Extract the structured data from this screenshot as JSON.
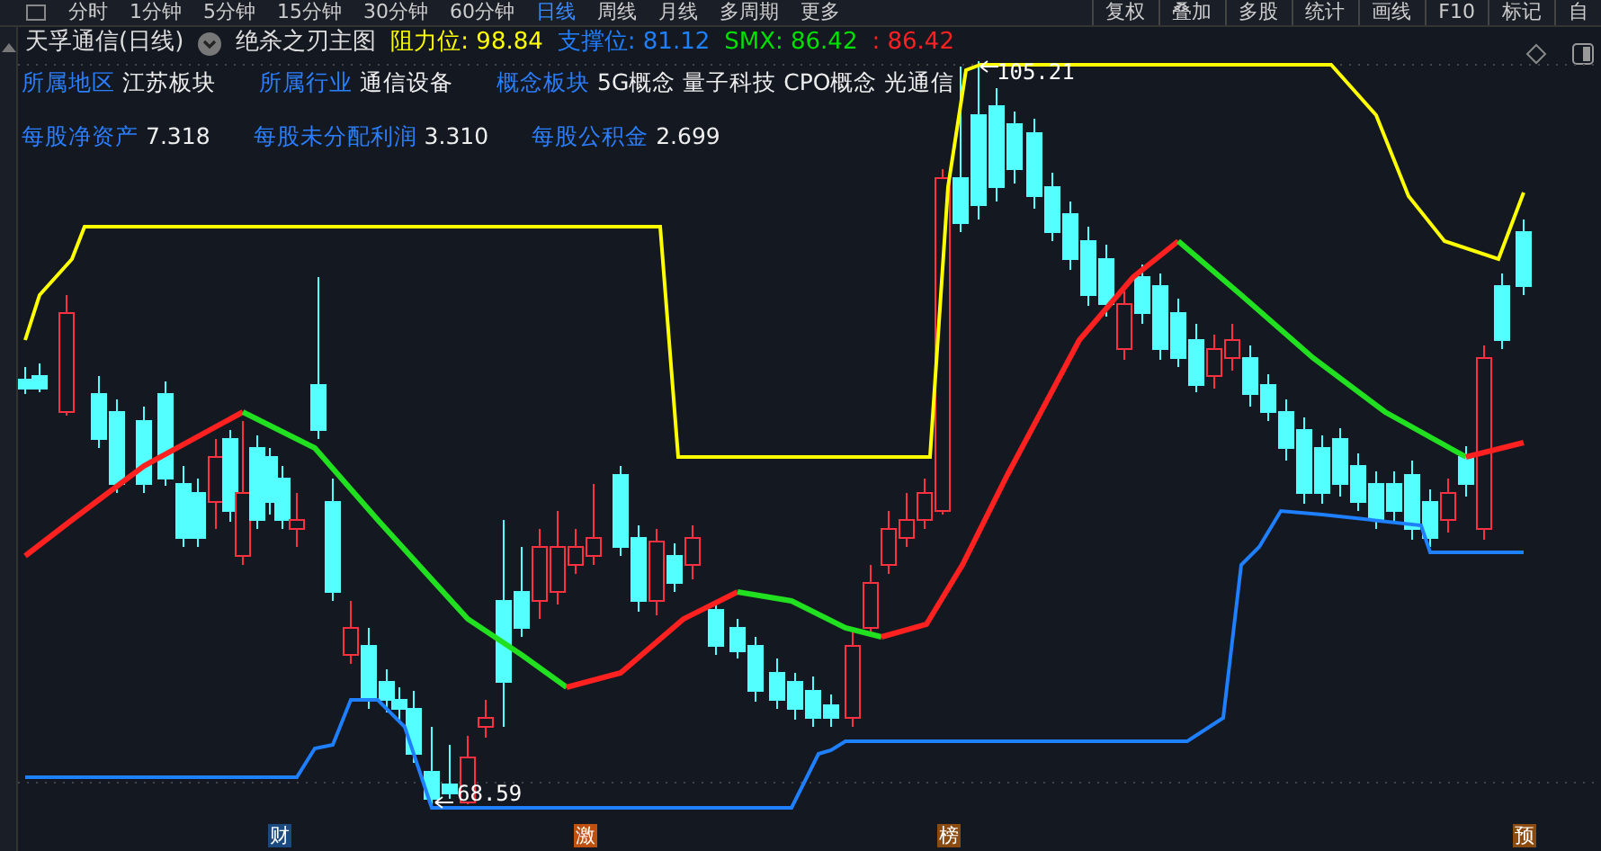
{
  "toolbar": {
    "tabs": [
      {
        "label": "分时",
        "selected": false
      },
      {
        "label": "1分钟",
        "selected": false
      },
      {
        "label": "5分钟",
        "selected": false
      },
      {
        "label": "15分钟",
        "selected": false
      },
      {
        "label": "30分钟",
        "selected": false
      },
      {
        "label": "60分钟",
        "selected": false
      },
      {
        "label": "日线",
        "selected": true
      },
      {
        "label": "周线",
        "selected": false
      },
      {
        "label": "月线",
        "selected": false
      },
      {
        "label": "多周期",
        "selected": false
      },
      {
        "label": "更多",
        "selected": false
      }
    ],
    "buttons": [
      "复权",
      "叠加",
      "多股",
      "统计",
      "画线",
      "F10",
      "标记",
      "自"
    ]
  },
  "title": {
    "name": "天孚通信(日线)",
    "indicator": "绝杀之刃主图",
    "readings": [
      {
        "label": "阻力位:",
        "value": "98.84",
        "color": "#ffff00"
      },
      {
        "label": "支撑位:",
        "value": "81.12",
        "color": "#1e7fff"
      },
      {
        "label": "SMX:",
        "value": "86.42",
        "color": "#00e000"
      },
      {
        "label": ":",
        "value": "86.42",
        "color": "#ff2020"
      }
    ]
  },
  "info_rows": [
    [
      {
        "label": "所属地区",
        "value": "江苏板块"
      },
      {
        "label": "所属行业",
        "value": "通信设备"
      },
      {
        "label": "概念板块",
        "value": "5G概念 量子科技 CPO概念 光通信"
      }
    ],
    [
      {
        "label": "每股净资产",
        "value": "7.318"
      },
      {
        "label": "每股未分配利润",
        "value": "3.310"
      },
      {
        "label": "每股公积金",
        "value": "2.699"
      }
    ]
  ],
  "chart": {
    "price_labels": [
      {
        "text": "105.21"
      },
      {
        "text": "68.59"
      }
    ]
  },
  "markers": [
    {
      "label": "财",
      "color": "#1a4a80"
    },
    {
      "label": "激",
      "color": "#c05010"
    },
    {
      "label": "榜",
      "color": "#8a4a10"
    },
    {
      "label": "预",
      "color": "#8a4a10"
    }
  ]
}
